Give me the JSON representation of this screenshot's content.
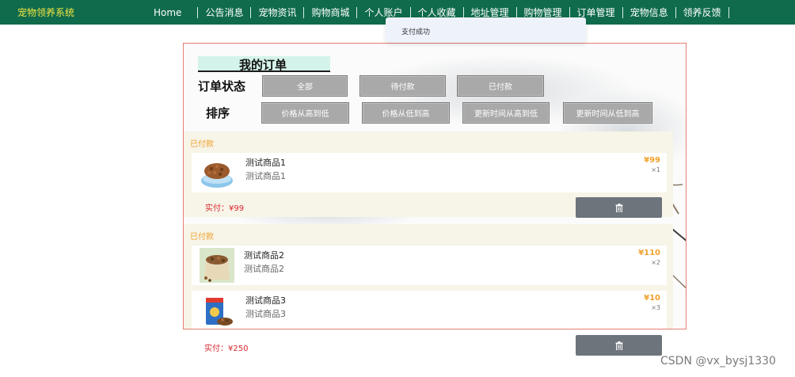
{
  "app": {
    "brand": "宠物领养系统"
  },
  "nav": {
    "home": "Home",
    "items": [
      "公告消息",
      "宠物资讯",
      "购物商城",
      "个人账户",
      "个人收藏",
      "地址管理",
      "购物管理",
      "订单管理",
      "宠物信息",
      "领养反馈"
    ]
  },
  "toast": {
    "message": "支付成功"
  },
  "page": {
    "title": "我的订单"
  },
  "filters": {
    "status_label": "订单状态",
    "status_options": [
      "全部",
      "待付款",
      "已付款"
    ],
    "sort_label": "排序",
    "sort_options": [
      "价格从高到低",
      "价格从低到高",
      "更新时间从高到低",
      "更新时间从低到高"
    ]
  },
  "orders": [
    {
      "status": "已付款",
      "items": [
        {
          "name": "测试商品1",
          "desc": "测试商品1",
          "price": "¥99",
          "qty": "×1",
          "image_icon": "dog-food-bowl-image"
        }
      ],
      "paid_label": "实付：",
      "paid_amount": "¥99",
      "delete_icon": "trash-icon"
    },
    {
      "status": "已付款",
      "items": [
        {
          "name": "测试商品2",
          "desc": "测试商品2",
          "price": "¥110",
          "qty": "×2",
          "image_icon": "pet-food-sack-image"
        },
        {
          "name": "测试商品3",
          "desc": "测试商品3",
          "price": "¥10",
          "qty": "×3",
          "image_icon": "dog-food-bag-image"
        }
      ],
      "paid_label": "实付：",
      "paid_amount": "¥250",
      "delete_icon": "trash-icon"
    }
  ],
  "watermark": "CSDN @vx_bysj1330",
  "colors": {
    "nav_bg": "#0f6b4c",
    "brand": "#f2e642",
    "status": "#f0a12b",
    "paid": "#d9262c",
    "filter_button": "#a9a9a9",
    "delete_button": "#6d747b",
    "panel_border": "#e57f73",
    "title_highlight": "#d4f3ea"
  }
}
